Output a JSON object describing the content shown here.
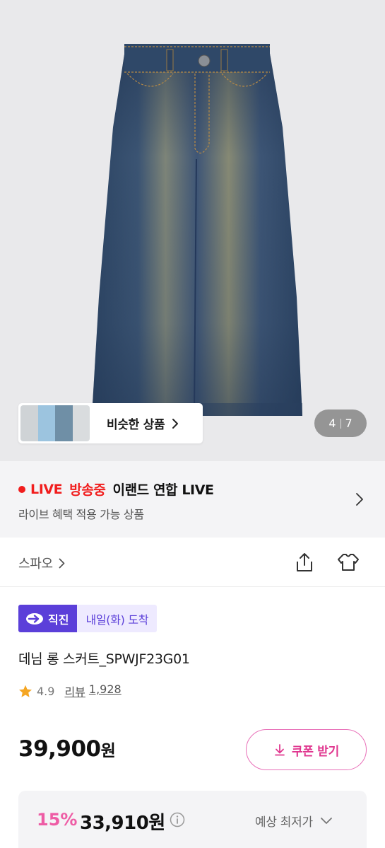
{
  "hero": {
    "similar_label": "비슷한 상품",
    "counter_current": "4",
    "counter_total": "7"
  },
  "live": {
    "tag": "LIVE",
    "on_air": "방송중",
    "title": "이랜드 연합 LIVE",
    "subtitle": "라이브 혜택 적용 가능 상품"
  },
  "brand": {
    "name": "스파오"
  },
  "badges": {
    "direct": "직진",
    "arrival": "내일(화) 도착"
  },
  "product": {
    "title": "데님 롱 스커트_SPWJF23G01",
    "rating": "4.9",
    "review_label": "리뷰",
    "review_count": "1,928",
    "price": "39,900",
    "price_unit": "원"
  },
  "coupon": {
    "label": "쿠폰 받기"
  },
  "discount": {
    "rate": "15%",
    "price": "33,910원",
    "lowest_label": "예상 최저가"
  },
  "colors": {
    "live_red": "#f11d1d",
    "direct_purple": "#5b3fd9",
    "coupon_pink": "#e0378f",
    "discount_pink": "#ee5ca5",
    "star": "#f5a623"
  },
  "icons": [
    "chevron-right-icon",
    "share-icon",
    "wardrobe-icon",
    "direct-arrow-icon",
    "star-icon",
    "download-icon",
    "info-icon",
    "chevron-down-icon"
  ]
}
